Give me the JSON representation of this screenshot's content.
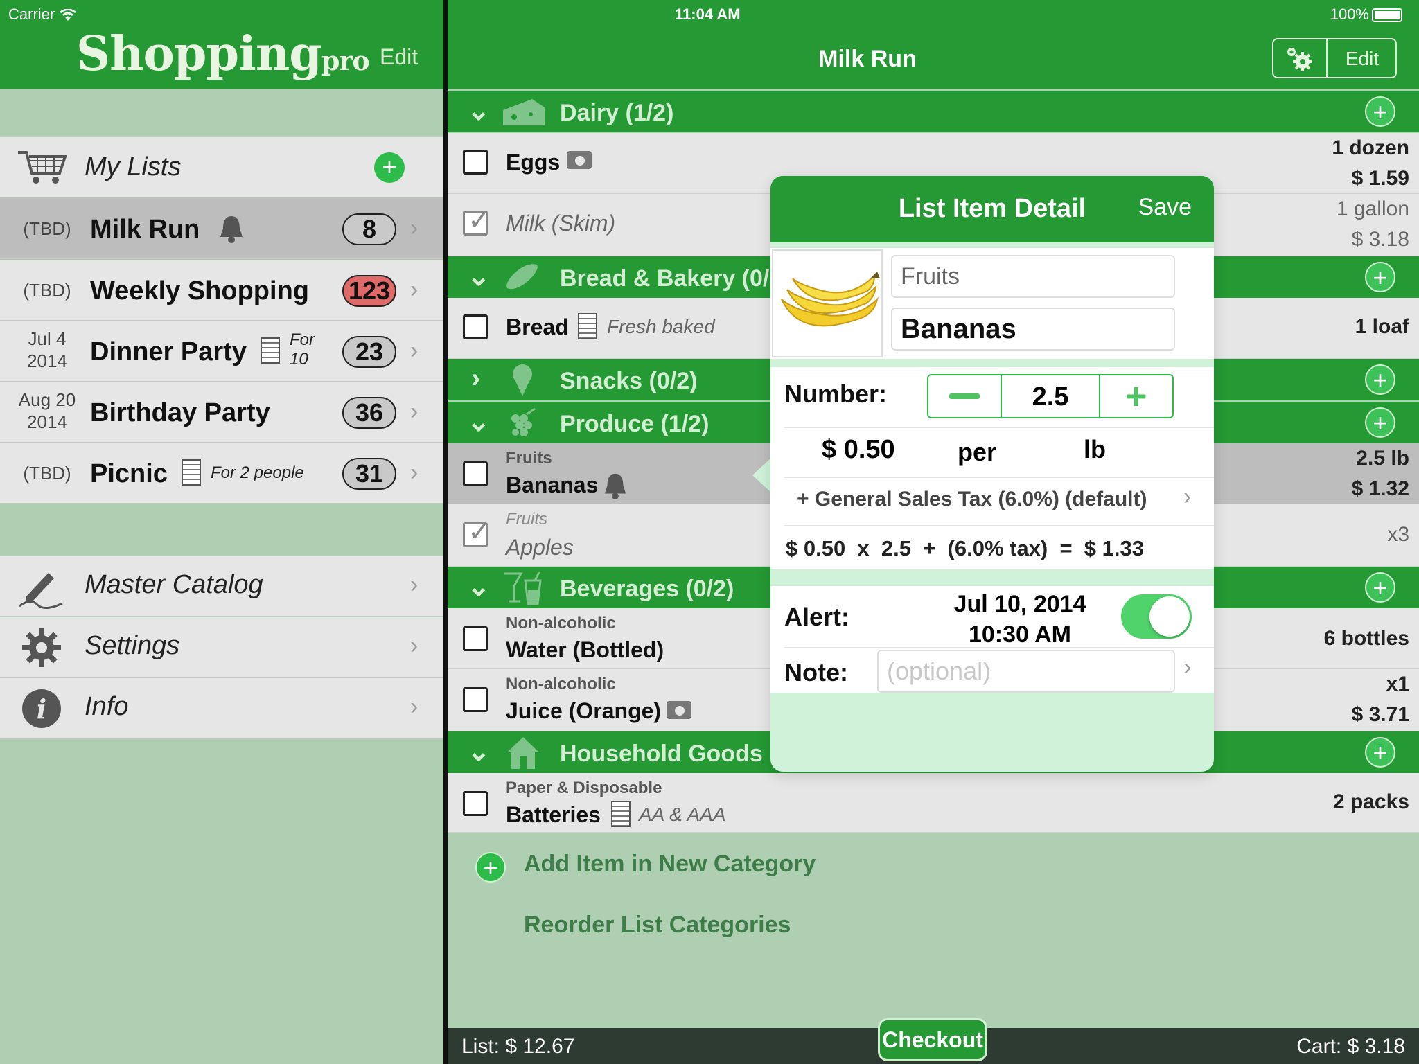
{
  "status": {
    "carrier": "Carrier",
    "time": "11:04 AM",
    "battery": "100%"
  },
  "sidebar": {
    "logo_main": "Shopping",
    "logo_suffix": "pro",
    "edit": "Edit",
    "my_lists": "My Lists",
    "lists": [
      {
        "date": "(TBD)",
        "name": "Milk Run",
        "note": "",
        "count": "8",
        "selected": true
      },
      {
        "date": "(TBD)",
        "name": "Weekly Shopping",
        "note": "",
        "count": "123"
      },
      {
        "date1": "Jul 4",
        "date2": "2014",
        "name": "Dinner Party",
        "note1": "For",
        "note2": "10",
        "count": "23"
      },
      {
        "date1": "Aug 20",
        "date2": "2014",
        "name": "Birthday Party",
        "count": "36"
      },
      {
        "date": "(TBD)",
        "name": "Picnic",
        "note": "For 2 people",
        "count": "31"
      }
    ],
    "menu": [
      {
        "label": "Master Catalog",
        "icon": "pencil-icon"
      },
      {
        "label": "Settings",
        "icon": "gear-icon"
      },
      {
        "label": "Info",
        "icon": "info-icon"
      }
    ]
  },
  "main": {
    "title": "Milk Run",
    "edit": "Edit",
    "categories": [
      {
        "title": "Dairy (1/2)"
      },
      {
        "title": "Bread & Bakery (0/"
      },
      {
        "title": "Snacks (0/2)"
      },
      {
        "title": "Produce (1/2)"
      },
      {
        "title": "Beverages (0/2)"
      },
      {
        "title": "Household Goods ("
      }
    ],
    "items": {
      "eggs": {
        "name": "Eggs",
        "qty1": "1 dozen",
        "qty2": "$ 1.59"
      },
      "milk": {
        "name": "Milk (Skim)",
        "qty1": "1 gallon",
        "qty2": "$ 3.18"
      },
      "bread": {
        "name": "Bread",
        "note": "Fresh baked",
        "qty1": "1 loaf"
      },
      "bananas": {
        "sub": "Fruits",
        "name": "Bananas",
        "qty1": "2.5 lb",
        "qty2": "$ 1.32"
      },
      "apples": {
        "sub": "Fruits",
        "name": "Apples",
        "qty1": "x3"
      },
      "water": {
        "sub": "Non-alcoholic",
        "name": "Water (Bottled)",
        "qty1": "6 bottles"
      },
      "juice": {
        "sub": "Non-alcoholic",
        "name": "Juice (Orange)",
        "qty1": "x1",
        "qty2": "$ 3.71"
      },
      "batteries": {
        "sub": "Paper & Disposable",
        "name": "Batteries",
        "note": "AA & AAA",
        "qty1": "2 packs"
      }
    },
    "add_category": "Add Item in New Category",
    "reorder": "Reorder List Categories",
    "footer": {
      "list_total": "List: $ 12.67",
      "checkout": "Checkout",
      "cart_total": "Cart: $ 3.18"
    }
  },
  "detail": {
    "title": "List Item Detail",
    "save": "Save",
    "category": "Fruits",
    "name": "Bananas",
    "number_label": "Number:",
    "number_value": "2.5",
    "price": "$ 0.50",
    "per": "per",
    "unit": "lb",
    "tax": "+ General Sales Tax (6.0%) (default)",
    "calc": "$ 0.50  x  2.5  +  (6.0% tax)  =  $ 1.33",
    "alert_label": "Alert:",
    "alert_date": "Jul 10, 2014",
    "alert_time": "10:30 AM",
    "alert_on": true,
    "note_label": "Note:",
    "note_placeholder": "(optional)"
  },
  "colors": {
    "green": "#249934",
    "light_green": "#aecfb2",
    "accent": "#2dbb4a"
  }
}
